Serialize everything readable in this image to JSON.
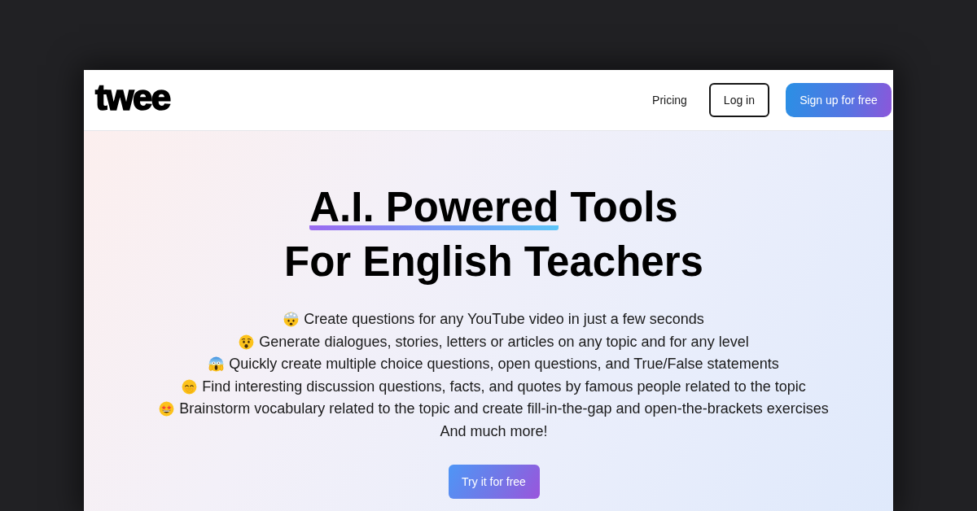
{
  "header": {
    "logo": "twee",
    "nav": [
      {
        "kind": "link",
        "label": "Pricing"
      },
      {
        "kind": "outline",
        "label": "Log in"
      },
      {
        "kind": "gradient",
        "label": "Sign up for free"
      }
    ]
  },
  "hero": {
    "title_line_1": [
      {
        "text": "A.I. Powered",
        "underlined": true
      },
      {
        "text": "Tools",
        "underlined": false
      }
    ],
    "title_line_2": "For English Teachers",
    "features": [
      {
        "kind": "mindblown",
        "text": "Create questions for any YouTube video in just a few seconds"
      },
      {
        "kind": "astonished",
        "text": "Generate dialogues, stories, letters or articles on any topic and for any level"
      },
      {
        "kind": "screaming",
        "text": "Quickly create multiple choice questions, open questions, and True/False statements"
      },
      {
        "kind": "giggling",
        "text": "Find interesting discussion questions, facts, and quotes by famous people related to the topic"
      },
      {
        "kind": "starstruck",
        "text": "Brainstorm vocabulary related to the topic and create fill-in-the-gap and open-the-brackets exercises"
      },
      {
        "kind": "plain",
        "text": "And much more!"
      }
    ],
    "cta": "Try it for free"
  }
}
